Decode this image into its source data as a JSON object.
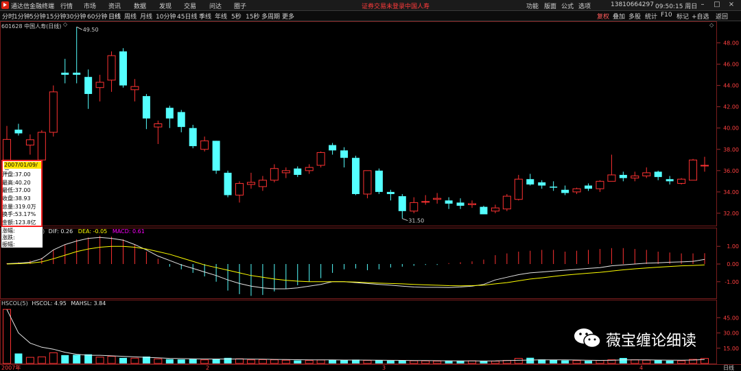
{
  "menubar": {
    "app_name": "通达信金融终端",
    "items": [
      "行情",
      "市场",
      "资讯",
      "数据",
      "发现",
      "交易",
      "问达",
      "圈子"
    ],
    "warning": "证券交易未登录",
    "stock_name": "中国人寿",
    "right_items": [
      "功能",
      "版面",
      "公式",
      "选项"
    ],
    "account": "13810664297",
    "clock": "09:50:15 周日"
  },
  "periodbar": {
    "periods": [
      "分时",
      "1分钟",
      "5分钟",
      "15分钟",
      "30分钟",
      "60分钟",
      "日线",
      "周线",
      "月线",
      "10分钟",
      "45日线",
      "季线",
      "年线",
      "5秒",
      "15秒",
      "多周期",
      "更多"
    ],
    "active": "日线",
    "right_buttons": [
      "复权",
      "叠加",
      "多股",
      "统计",
      "F10",
      "标记",
      "+自选",
      "返回"
    ]
  },
  "chart_header": {
    "title": "601628 中国人寿(日线)"
  },
  "info_box": {
    "date": "2007/01/09/二",
    "rows": [
      "开盘:37.00",
      "最高:40.20",
      "最低:37.00",
      "收盘:38.93",
      "总量:319.0万",
      "换手:53.17%",
      "金额:123.8亿",
      "涨幅:",
      "涨跌:",
      "振幅:"
    ]
  },
  "annotations": {
    "high": "49.50",
    "low": "31.50"
  },
  "macd_legend": {
    "prefix": ")",
    "dif": "DIF: 0.26",
    "dea": "DEA: -0.05",
    "macd": "MACD: 0.61"
  },
  "volume_legend": {
    "name": "HSCOL(5)",
    "hscol": "HSCOL: 4.95",
    "mahsl": "MAHSL: 3.84"
  },
  "time_axis": {
    "labels": [
      "2007年",
      "2",
      "3",
      "4"
    ],
    "period_label": "日线"
  },
  "watermark": {
    "text": "薇宝缠论细读"
  },
  "colors": {
    "up": "#ff3232",
    "down": "#54ffff",
    "dif": "#e6e6e6",
    "dea": "#ffff00",
    "macd": "#ff00ff",
    "warning": "#ff3b3b"
  },
  "chart_data": [
    {
      "type": "candlestick",
      "title": "601628 中国人寿(日线)",
      "price_axis_ticks": [
        32.0,
        34.0,
        36.0,
        38.0,
        40.0,
        42.0,
        44.0,
        46.0,
        48.0
      ],
      "ylim": [
        30.9,
        49.9
      ],
      "candles": [
        {
          "o": 37.0,
          "h": 40.2,
          "l": 37.0,
          "c": 38.93
        },
        {
          "o": 39.85,
          "h": 40.4,
          "l": 39.3,
          "c": 39.5
        },
        {
          "o": 38.4,
          "h": 39.4,
          "l": 37.5,
          "c": 38.9
        },
        {
          "o": 37.0,
          "h": 39.8,
          "l": 36.8,
          "c": 39.6
        },
        {
          "o": 39.6,
          "h": 44.0,
          "l": 39.2,
          "c": 43.4
        },
        {
          "o": 45.2,
          "h": 46.5,
          "l": 44.2,
          "c": 45.0
        },
        {
          "o": 45.2,
          "h": 49.5,
          "l": 44.2,
          "c": 45.0
        },
        {
          "o": 44.8,
          "h": 45.5,
          "l": 41.8,
          "c": 43.2
        },
        {
          "o": 43.8,
          "h": 45.0,
          "l": 42.5,
          "c": 44.3
        },
        {
          "o": 44.5,
          "h": 47.2,
          "l": 43.4,
          "c": 46.8
        },
        {
          "o": 47.2,
          "h": 47.5,
          "l": 43.8,
          "c": 44.0
        },
        {
          "o": 43.6,
          "h": 44.6,
          "l": 42.5,
          "c": 43.9
        },
        {
          "o": 43.0,
          "h": 43.2,
          "l": 39.9,
          "c": 40.9
        },
        {
          "o": 40.1,
          "h": 40.7,
          "l": 38.5,
          "c": 40.4
        },
        {
          "o": 41.9,
          "h": 42.1,
          "l": 40.0,
          "c": 40.9
        },
        {
          "o": 41.5,
          "h": 41.7,
          "l": 39.6,
          "c": 40.1
        },
        {
          "o": 40.0,
          "h": 40.3,
          "l": 38.1,
          "c": 38.3
        },
        {
          "o": 38.0,
          "h": 39.2,
          "l": 37.8,
          "c": 38.8
        },
        {
          "o": 38.8,
          "h": 38.8,
          "l": 35.7,
          "c": 36.0
        },
        {
          "o": 35.8,
          "h": 36.0,
          "l": 33.5,
          "c": 33.7
        },
        {
          "o": 33.7,
          "h": 35.0,
          "l": 33.0,
          "c": 34.8
        },
        {
          "o": 34.7,
          "h": 35.8,
          "l": 34.3,
          "c": 34.9
        },
        {
          "o": 34.5,
          "h": 35.5,
          "l": 34.1,
          "c": 35.1
        },
        {
          "o": 35.1,
          "h": 36.6,
          "l": 34.9,
          "c": 36.2
        },
        {
          "o": 35.8,
          "h": 36.3,
          "l": 35.3,
          "c": 36.0
        },
        {
          "o": 36.2,
          "h": 36.4,
          "l": 35.4,
          "c": 35.6
        },
        {
          "o": 36.0,
          "h": 36.6,
          "l": 35.7,
          "c": 36.3
        },
        {
          "o": 36.5,
          "h": 37.8,
          "l": 36.3,
          "c": 37.7
        },
        {
          "o": 38.4,
          "h": 38.6,
          "l": 37.5,
          "c": 37.9
        },
        {
          "o": 37.9,
          "h": 38.2,
          "l": 36.3,
          "c": 37.2
        },
        {
          "o": 37.2,
          "h": 37.4,
          "l": 33.7,
          "c": 33.8
        },
        {
          "o": 33.8,
          "h": 36.0,
          "l": 33.4,
          "c": 36.0
        },
        {
          "o": 36.0,
          "h": 36.2,
          "l": 33.8,
          "c": 34.0
        },
        {
          "o": 34.0,
          "h": 34.2,
          "l": 33.2,
          "c": 33.8
        },
        {
          "o": 33.6,
          "h": 33.8,
          "l": 31.5,
          "c": 32.2
        },
        {
          "o": 32.2,
          "h": 33.5,
          "l": 32.0,
          "c": 33.0
        },
        {
          "o": 33.1,
          "h": 33.7,
          "l": 32.8,
          "c": 33.1
        },
        {
          "o": 33.3,
          "h": 33.9,
          "l": 32.9,
          "c": 33.4
        },
        {
          "o": 33.2,
          "h": 33.5,
          "l": 32.4,
          "c": 32.9
        },
        {
          "o": 33.0,
          "h": 33.4,
          "l": 32.4,
          "c": 32.7
        },
        {
          "o": 32.8,
          "h": 33.2,
          "l": 32.5,
          "c": 32.9
        },
        {
          "o": 32.6,
          "h": 32.7,
          "l": 31.9,
          "c": 31.9
        },
        {
          "o": 32.2,
          "h": 32.8,
          "l": 32.0,
          "c": 32.5
        },
        {
          "o": 32.4,
          "h": 33.8,
          "l": 32.2,
          "c": 33.6
        },
        {
          "o": 33.3,
          "h": 35.6,
          "l": 33.2,
          "c": 35.2
        },
        {
          "o": 35.2,
          "h": 35.7,
          "l": 34.6,
          "c": 34.7
        },
        {
          "o": 34.9,
          "h": 35.1,
          "l": 34.3,
          "c": 34.6
        },
        {
          "o": 34.5,
          "h": 35.0,
          "l": 34.1,
          "c": 34.4
        },
        {
          "o": 34.2,
          "h": 34.6,
          "l": 33.7,
          "c": 33.9
        },
        {
          "o": 34.0,
          "h": 34.4,
          "l": 33.8,
          "c": 34.3
        },
        {
          "o": 34.6,
          "h": 34.8,
          "l": 34.1,
          "c": 34.3
        },
        {
          "o": 34.3,
          "h": 35.1,
          "l": 34.0,
          "c": 35.0
        },
        {
          "o": 35.0,
          "h": 37.5,
          "l": 35.0,
          "c": 35.6
        },
        {
          "o": 35.6,
          "h": 35.9,
          "l": 35.0,
          "c": 35.3
        },
        {
          "o": 35.3,
          "h": 35.9,
          "l": 35.0,
          "c": 35.5
        },
        {
          "o": 35.5,
          "h": 36.3,
          "l": 35.3,
          "c": 35.8
        },
        {
          "o": 35.9,
          "h": 36.0,
          "l": 35.1,
          "c": 35.4
        },
        {
          "o": 35.2,
          "h": 35.5,
          "l": 34.7,
          "c": 35.0
        },
        {
          "o": 34.8,
          "h": 35.3,
          "l": 34.7,
          "c": 35.2
        },
        {
          "o": 35.1,
          "h": 37.1,
          "l": 35.1,
          "c": 37.0
        },
        {
          "o": 36.5,
          "h": 37.3,
          "l": 35.9,
          "c": 36.5
        }
      ]
    },
    {
      "type": "macd",
      "axis_ticks": [
        -1.0,
        0.0,
        1.0
      ],
      "ylim": [
        -1.9,
        1.9
      ],
      "macd": [
        0.05,
        0.1,
        0.2,
        0.35,
        0.8,
        1.1,
        1.4,
        1.5,
        1.6,
        1.55,
        1.4,
        1.1,
        0.7,
        0.3,
        -0.15,
        -0.3,
        -0.5,
        -0.7,
        -1.0,
        -1.5,
        -1.7,
        -1.8,
        -1.75,
        -1.55,
        -1.4,
        -1.2,
        -1.0,
        -0.8,
        -0.5,
        -0.3,
        -0.25,
        -0.35,
        -0.3,
        -0.2,
        -0.15,
        -0.1,
        -0.05,
        -0.05,
        0.05,
        0.1,
        0.15,
        0.25,
        0.5,
        0.6,
        0.7,
        0.75,
        0.8,
        0.8,
        0.7,
        0.75,
        0.8,
        0.85,
        0.9,
        0.9,
        0.85,
        0.8,
        0.7,
        0.65,
        0.6,
        0.6,
        0.61
      ],
      "dif": [
        0.02,
        0.05,
        0.1,
        0.3,
        0.8,
        1.1,
        1.3,
        1.45,
        1.5,
        1.45,
        1.35,
        1.1,
        0.8,
        0.45,
        0.2,
        -0.05,
        -0.25,
        -0.45,
        -0.65,
        -0.9,
        -1.1,
        -1.25,
        -1.35,
        -1.4,
        -1.4,
        -1.35,
        -1.25,
        -1.15,
        -1.0,
        -1.0,
        -1.05,
        -1.1,
        -1.15,
        -1.2,
        -1.25,
        -1.3,
        -1.32,
        -1.32,
        -1.33,
        -1.3,
        -1.25,
        -1.15,
        -0.9,
        -0.75,
        -0.6,
        -0.5,
        -0.45,
        -0.4,
        -0.35,
        -0.3,
        -0.25,
        -0.2,
        -0.1,
        -0.05,
        0.0,
        0.05,
        0.07,
        0.1,
        0.12,
        0.15,
        0.26
      ],
      "dea": [
        0.0,
        0.02,
        0.05,
        0.12,
        0.3,
        0.5,
        0.7,
        0.85,
        0.95,
        1.0,
        1.0,
        0.95,
        0.85,
        0.7,
        0.55,
        0.35,
        0.15,
        -0.05,
        -0.2,
        -0.35,
        -0.5,
        -0.65,
        -0.75,
        -0.85,
        -0.92,
        -0.97,
        -1.0,
        -1.0,
        -1.0,
        -1.0,
        -1.02,
        -1.05,
        -1.08,
        -1.1,
        -1.12,
        -1.15,
        -1.18,
        -1.2,
        -1.22,
        -1.23,
        -1.22,
        -1.2,
        -1.12,
        -1.05,
        -0.95,
        -0.85,
        -0.78,
        -0.7,
        -0.63,
        -0.57,
        -0.52,
        -0.47,
        -0.4,
        -0.33,
        -0.27,
        -0.22,
        -0.18,
        -0.14,
        -0.1,
        -0.08,
        -0.05
      ]
    },
    {
      "type": "bar",
      "name": "HSCOL(5)",
      "axis_ticks": [
        15.0,
        30.0,
        45.0
      ],
      "ylim": [
        0,
        60
      ],
      "values": [
        53.17,
        9.8,
        6.0,
        6.5,
        10.5,
        8.2,
        8.5,
        9.0,
        6.2,
        7.0,
        5.5,
        5.2,
        6.8,
        4.5,
        4.2,
        4.0,
        4.3,
        3.5,
        4.6,
        5.5,
        4.6,
        3.5,
        3.8,
        3.6,
        3.2,
        3.0,
        3.0,
        3.4,
        3.6,
        3.2,
        3.8,
        3.0,
        3.4,
        2.8,
        3.0,
        2.6,
        2.5,
        2.3,
        2.5,
        2.4,
        2.6,
        2.2,
        2.3,
        3.0,
        5.0,
        5.6,
        4.0,
        3.4,
        3.0,
        2.8,
        2.6,
        3.0,
        3.6,
        5.4,
        3.6,
        3.2,
        3.0,
        2.8,
        2.6,
        4.0,
        4.95
      ],
      "mahsl": [
        53.0,
        30.0,
        20.0,
        16.0,
        14.0,
        11.0,
        9.0,
        8.0,
        8.0,
        7.5,
        7.0,
        6.5,
        6.0,
        5.5,
        5.0,
        4.8,
        4.6,
        4.4,
        4.4,
        4.4,
        4.4,
        4.3,
        4.2,
        4.0,
        3.9,
        3.7,
        3.6,
        3.5,
        3.5,
        3.4,
        3.4,
        3.3,
        3.2,
        3.1,
        3.0,
        2.9,
        2.8,
        2.7,
        2.6,
        2.5,
        2.5,
        2.4,
        2.5,
        2.8,
        3.1,
        3.4,
        3.5,
        3.6,
        3.6,
        3.4,
        3.2,
        3.0,
        3.1,
        3.5,
        3.6,
        3.6,
        3.4,
        3.3,
        3.2,
        3.4,
        3.84
      ]
    }
  ]
}
